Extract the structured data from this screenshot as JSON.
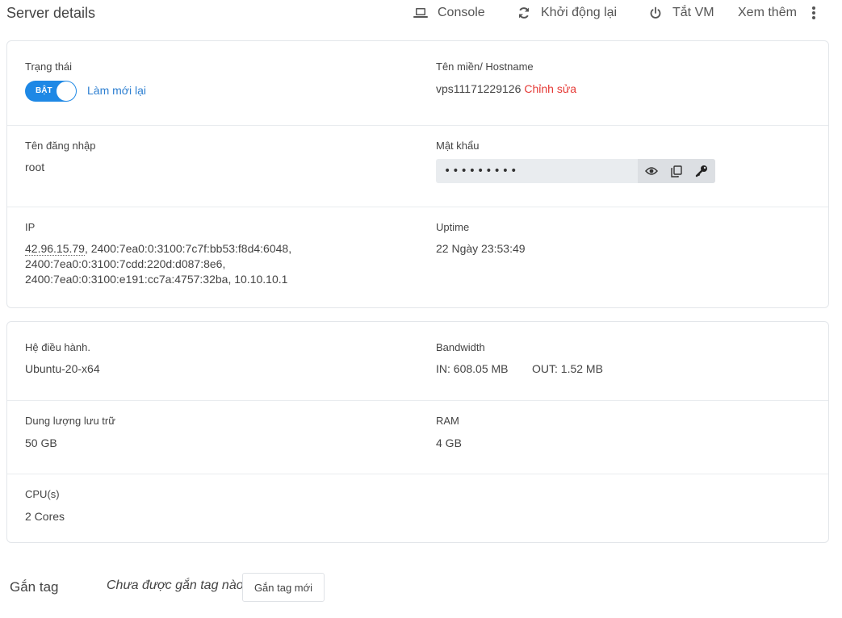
{
  "header": {
    "title": "Server details",
    "actions": [
      {
        "label": "Console",
        "icon": "laptop-icon"
      },
      {
        "label": "Khởi động lại",
        "icon": "refresh-icon"
      },
      {
        "label": "Tắt VM",
        "icon": "power-icon"
      },
      {
        "label": "Xem thêm",
        "icon": "more-vertical-icon"
      }
    ]
  },
  "status": {
    "label": "Trạng thái",
    "toggle_text": "BẬT",
    "toggle_on": true,
    "refresh_link": "Làm mới lại"
  },
  "hostname": {
    "label": "Tên miền/ Hostname",
    "value": "vps11171229126",
    "edit_link": "Chỉnh sửa"
  },
  "login": {
    "label": "Tên đăng nhập",
    "value": "root"
  },
  "password": {
    "label": "Mật khẩu",
    "masked_value": "•••••••••",
    "action_icons": [
      "eye-icon",
      "copy-icon",
      "key-icon"
    ]
  },
  "ip": {
    "label": "IP",
    "line1_first": "42.96.15.79",
    "line1_rest": ", 2400:7ea0:0:3100:7c7f:bb53:f8d4:6048,",
    "line2": "2400:7ea0:0:3100:7cdd:220d:d087:8e6,",
    "line3": "2400:7ea0:0:3100:e191:cc7a:4757:32ba, 10.10.10.1"
  },
  "uptime": {
    "label": "Uptime",
    "value": "22 Ngày 23:53:49"
  },
  "os": {
    "label": "Hệ điều hành.",
    "value": "Ubuntu-20-x64"
  },
  "bandwidth": {
    "label": "Bandwidth",
    "in": "IN: 608.05 MB",
    "out": "OUT: 1.52 MB"
  },
  "storage": {
    "label": "Dung lượng lưu trữ",
    "value": "50 GB"
  },
  "ram": {
    "label": "RAM",
    "value": "4 GB"
  },
  "cpu": {
    "label": "CPU(s)",
    "value": "2 Cores"
  },
  "tags": {
    "label": "Gắn tag",
    "empty_text": "Chưa được gắn tag nào",
    "add_button": "Gắn tag mới"
  },
  "colors": {
    "accent": "#1e88e5",
    "link": "#2d7fd1",
    "edit": "#e53935",
    "border": "#e3e6ea"
  }
}
